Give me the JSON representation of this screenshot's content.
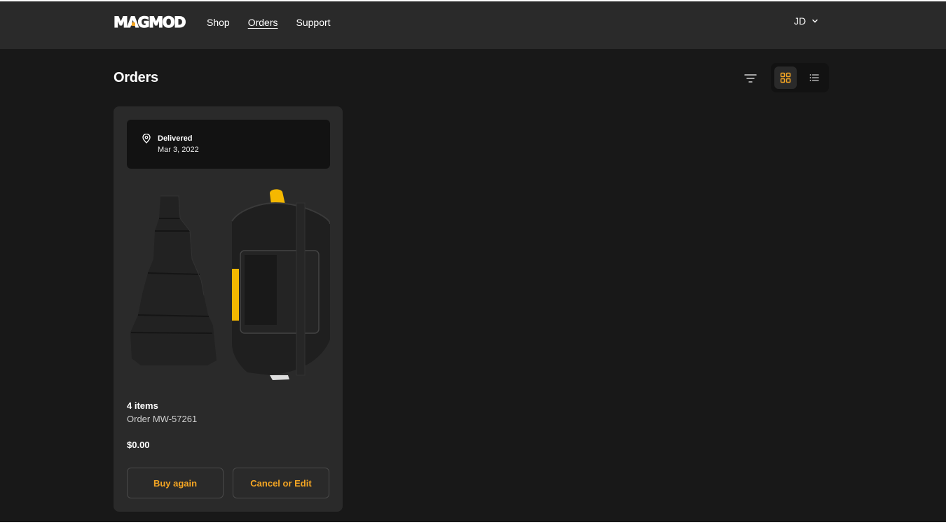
{
  "header": {
    "logo_text_left": "M",
    "logo_text_a": "A",
    "logo_text_right": "GMOD",
    "nav": [
      {
        "label": "Shop",
        "active": false
      },
      {
        "label": "Orders",
        "active": true
      },
      {
        "label": "Support",
        "active": false
      }
    ],
    "user_initials": "JD",
    "user_menu_icon": "chevron-down-icon"
  },
  "page": {
    "title": "Orders",
    "filter_icon": "filter-icon",
    "view_modes": [
      {
        "name": "grid-view-icon",
        "selected": true
      },
      {
        "name": "list-view-icon",
        "selected": false
      }
    ]
  },
  "orders": [
    {
      "status": "Delivered",
      "status_date": "Mar 3, 2022",
      "status_icon": "location-pin-icon",
      "items_count": "4 items",
      "order_number": "Order MW-57261",
      "total": "$0.00",
      "products": [
        "snoot-product-image",
        "magmod-grid-holder-product-image"
      ],
      "actions": {
        "buy_again": "Buy again",
        "cancel_or_edit": "Cancel or Edit"
      }
    }
  ],
  "colors": {
    "accent": "#f5a623",
    "background": "#181818",
    "header": "#2a2a2a",
    "card": "#2a2a2a",
    "panel": "#121212"
  }
}
